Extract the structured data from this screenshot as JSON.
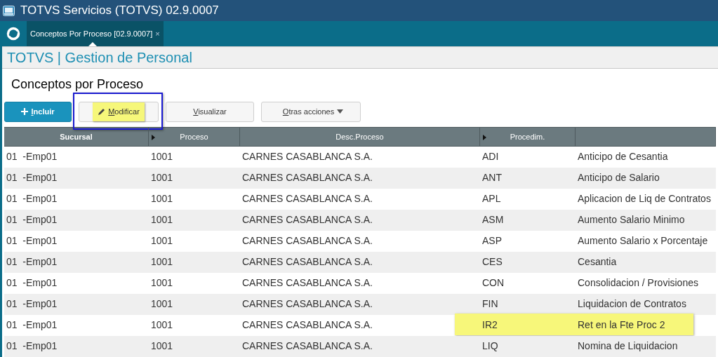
{
  "window": {
    "title": "TOTVS Servicios (TOTVS) 02.9.0007"
  },
  "tabs": [
    {
      "label": "Conceptos Por Proceso [02.9.0007]",
      "close": "×",
      "selected": true
    }
  ],
  "app_header": "TOTVS | Gestion de Personal",
  "page_title": "Conceptos por Proceso",
  "toolbar": [
    {
      "label": "Incluir",
      "kind": "add",
      "underline_first": true,
      "highlighted": false,
      "outlined": false
    },
    {
      "label": "Modificar",
      "kind": "edit",
      "underline_first": true,
      "highlighted": true,
      "outlined": true
    },
    {
      "label": "Visualizar",
      "kind": "plain",
      "underline_first": true,
      "highlighted": false,
      "outlined": false
    },
    {
      "label": "Otras acciones",
      "kind": "dropdown",
      "underline_first": true,
      "highlighted": false,
      "outlined": false
    }
  ],
  "table": {
    "columns": [
      {
        "label": "Sucursal",
        "sort_marker": false
      },
      {
        "label": "Proceso",
        "sort_marker": true
      },
      {
        "label": "Desc.Proceso",
        "sort_marker": false
      },
      {
        "label": "Procedim.",
        "sort_marker": true
      },
      {
        "sort_marker": false
      }
    ],
    "rows": [
      {
        "cells": [
          "01  -Emp01",
          "1001",
          "CARNES CASABLANCA S.A.",
          "ADI",
          "Anticipo de Cesantia"
        ],
        "highlighted": false
      },
      {
        "cells": [
          "01  -Emp01",
          "1001",
          "CARNES CASABLANCA S.A.",
          "ANT",
          "Anticipo de Salario"
        ],
        "highlighted": false
      },
      {
        "cells": [
          "01  -Emp01",
          "1001",
          "CARNES CASABLANCA S.A.",
          "APL",
          "Aplicacion de Liq de Contratos"
        ],
        "highlighted": false
      },
      {
        "cells": [
          "01  -Emp01",
          "1001",
          "CARNES CASABLANCA S.A.",
          "ASM",
          "Aumento Salario Minimo"
        ],
        "highlighted": false
      },
      {
        "cells": [
          "01  -Emp01",
          "1001",
          "CARNES CASABLANCA S.A.",
          "ASP",
          "Aumento Salario x Porcentaje"
        ],
        "highlighted": false
      },
      {
        "cells": [
          "01  -Emp01",
          "1001",
          "CARNES CASABLANCA S.A.",
          "CES",
          "Cesantia"
        ],
        "highlighted": false
      },
      {
        "cells": [
          "01  -Emp01",
          "1001",
          "CARNES CASABLANCA S.A.",
          "CON",
          "Consolidacion / Provisiones"
        ],
        "highlighted": false
      },
      {
        "cells": [
          "01  -Emp01",
          "1001",
          "CARNES CASABLANCA S.A.",
          "FIN",
          "Liquidacion de Contratos"
        ],
        "highlighted": false
      },
      {
        "cells": [
          "01  -Emp01",
          "1001",
          "CARNES CASABLANCA S.A.",
          "IR2",
          "Ret en la Fte Proc 2"
        ],
        "highlighted": true
      },
      {
        "cells": [
          "01  -Emp01",
          "1001",
          "CARNES CASABLANCA S.A.",
          "LIQ",
          "Nomina de Liquidacion"
        ],
        "highlighted": false
      }
    ]
  }
}
